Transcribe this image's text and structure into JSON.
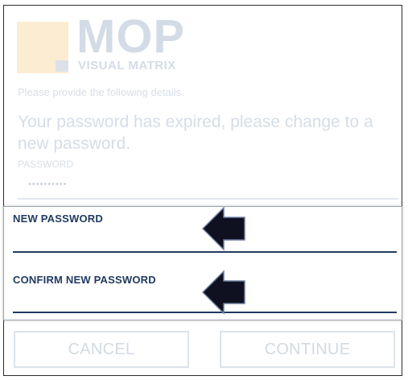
{
  "logo": {
    "brand": "MOP",
    "subtitle": "VISUAL MATRIX"
  },
  "form": {
    "intro": "Please provide the following details.",
    "headline": "Your password has expired, please change to a new password.",
    "password_label": "PASSWORD",
    "password_value": "••••••••••",
    "new_password_label": "NEW PASSWORD",
    "confirm_password_label": "CONFIRM NEW PASSWORD"
  },
  "actions": {
    "cancel_label": "CANCEL",
    "continue_label": "CONTINUE"
  },
  "colors": {
    "accent": "#1f3a5f",
    "arrow": "#0f1020",
    "faded_text": "#d6dde7",
    "logo_square": "#fcecd2"
  },
  "annotations": {
    "arrow_icon": "arrow-left-icon"
  }
}
